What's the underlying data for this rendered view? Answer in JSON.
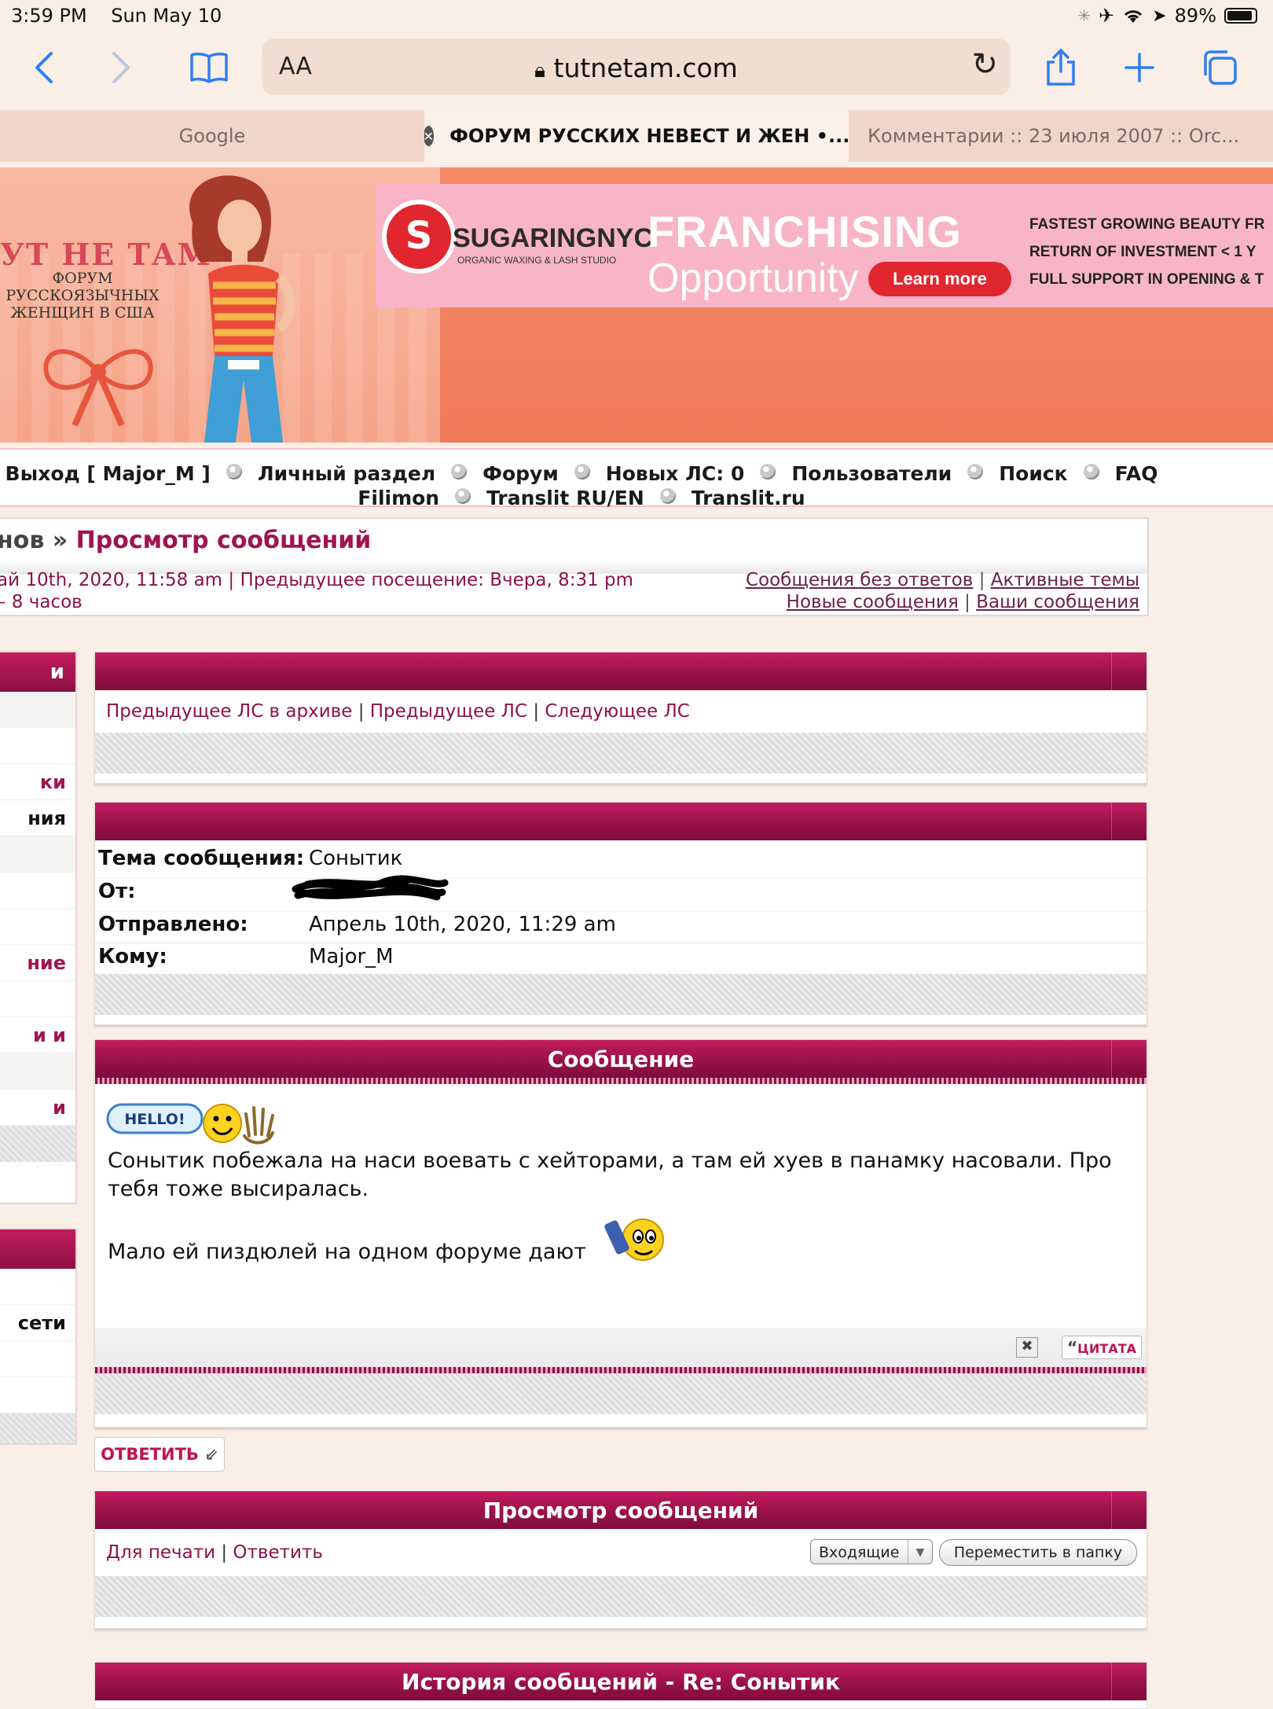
{
  "status_bar": {
    "time": "3:59 PM",
    "date": "Sun May 10",
    "battery": "89%"
  },
  "browser": {
    "aa": "AA",
    "url": "tutnetam.com",
    "tabs": [
      {
        "label": "Google"
      },
      {
        "label": "ФОРУМ РУССКИХ НЕВЕСТ И ЖЕН •..."
      },
      {
        "label": "Комментарии :: 23 июля 2007 :: Orc..."
      }
    ]
  },
  "header": {
    "logo_title": "УТ НЕ ТАМ",
    "logo_sub": [
      "ФОРУМ",
      "РУССКОЯЗЫЧНЫХ",
      "ЖЕНЩИН В США"
    ],
    "ad": {
      "brand": "SUGARINGNYC",
      "brand_sub": "ORGANIC WAXING & LASH STUDIO",
      "headline": "FRANCHISING",
      "subheadline": "Opportunity",
      "button": "Learn more",
      "bullets": [
        "FASTEST GROWING BEAUTY FR",
        "RETURN OF INVESTMENT < 1 Y",
        "FULL SUPPORT IN OPENING & T"
      ]
    }
  },
  "nav": {
    "row1": [
      "Выход [ Major_M ]",
      "Личный раздел",
      "Форум",
      "Новых ЛС: 0",
      "Пользователи",
      "Поиск",
      "FAQ"
    ],
    "row2": [
      "Filimon",
      "Translit RU/EN",
      "Translit.ru"
    ]
  },
  "breadcrumb": {
    "prefix": "нов",
    "sep": "»",
    "current": "Просмотр сообщений",
    "last_visit_line1": "ай 10th, 2020, 11:58 am | Предыдущее посещение: Вчера, 8:31 pm",
    "last_visit_line2": "– 8 часов",
    "quick": {
      "unanswered": "Сообщения без ответов",
      "active": "Активные темы",
      "new_posts": "Новые сообщения",
      "your_posts": "Ваши сообщения"
    }
  },
  "sidebar": {
    "box1": {
      "caption": "и",
      "rows": [
        "",
        "",
        "ки",
        "ния",
        "",
        "",
        "",
        "ние",
        "",
        "и и",
        "",
        "и"
      ]
    },
    "box2": {
      "caption": "",
      "rows": [
        "",
        "сети",
        "",
        ""
      ]
    }
  },
  "pm_nav": {
    "prev_archive": "Предыдущее ЛС в архиве",
    "prev": "Предыдущее ЛС",
    "next": "Следующее ЛС"
  },
  "pm_info": {
    "subject_label": "Тема сообщения:",
    "subject": "Сонытик",
    "from_label": "От:",
    "sent_label": "Отправлено:",
    "sent": "Апрель 10th, 2020, 11:29 am",
    "to_label": "Кому:",
    "to": "Major_M"
  },
  "message": {
    "title": "Сообщение",
    "hello_badge": "HELLO!",
    "text1": "Сонытик побежала на наси воевать с хейторами, а там ей хуев в панамку насовали. Про тебя тоже высиралась.",
    "text2": "Мало ей пиздюлей на одном форуме дают",
    "delete_icon": "✖",
    "quote_label": "ЦИТАТА"
  },
  "reply_button": "ОТВЕТИТЬ",
  "view_panel": {
    "title": "Просмотр сообщений",
    "print": "Для печати",
    "reply": "Ответить",
    "folder_selected": "Входящие",
    "move_button": "Переместить в папку"
  },
  "history_panel": {
    "title": "История сообщений - Re: Сонытик"
  },
  "colors": {
    "accent": "#9a1149",
    "link": "#8e1149",
    "banner": "#ef7a57"
  }
}
